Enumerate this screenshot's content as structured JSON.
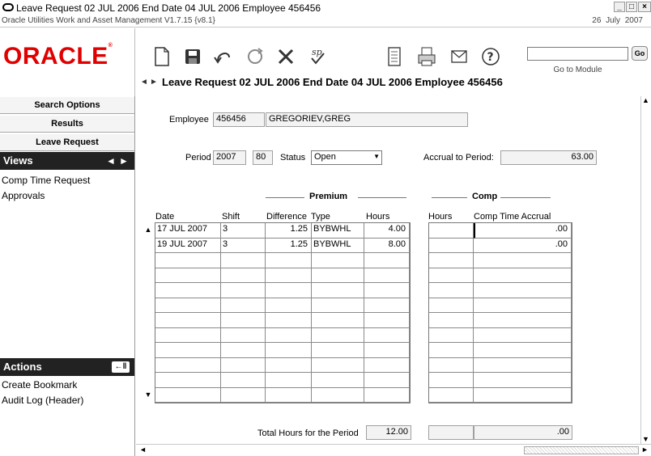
{
  "window": {
    "title": "Leave Request 02 JUL 2006 End Date 04 JUL 2006 Employee 456456",
    "subtitle": "Oracle Utilities Work and Asset Management V1.7.15 {v8.1}",
    "date": "26 July  2007",
    "minimize": "_",
    "maximize": "□",
    "close": "×"
  },
  "logo": {
    "text": "ORACLE",
    "reg": "®"
  },
  "toolbar": {
    "goto_label": "Go to Module",
    "goto_value": "",
    "go_label": "Go",
    "record_title": "Leave Request 02 JUL 2006 End Date 04 JUL 2006 Employee 456456",
    "prev_icon": "◄",
    "next_icon": "►",
    "icons": [
      "new-document-icon",
      "save-icon",
      "undo-icon",
      "refresh-icon",
      "delete-icon",
      "spell-check-icon",
      "report-icon",
      "print-icon",
      "mail-icon",
      "help-icon"
    ]
  },
  "sidebar": {
    "search_options": "Search Options",
    "results": "Results",
    "leave_request": "Leave Request",
    "views_header": "Views",
    "views_items": [
      "Comp Time Request",
      "Approvals"
    ],
    "actions_header": "Actions",
    "actions_items": [
      "Create Bookmark",
      "Audit Log (Header)"
    ],
    "arrow_left": "◄",
    "arrow_right": "►"
  },
  "form": {
    "employee_label": "Employee",
    "employee_id": "456456",
    "employee_name": "GREGORIEV,GREG",
    "period_label": "Period",
    "period_year": "2007",
    "period_num": "80",
    "status_label": "Status",
    "status_value": "Open",
    "accrual_label": "Accrual to Period:",
    "accrual_value": "63.00"
  },
  "grid": {
    "premium_header": "Premium",
    "comp_header": "Comp",
    "columns": {
      "date": "Date",
      "shift": "Shift",
      "difference": "Difference",
      "type": "Type",
      "hours": "Hours",
      "comp_hours": "Hours",
      "comp_accrual": "Comp Time Accrual"
    },
    "rows": [
      {
        "date": "17 JUL 2007",
        "shift": "3",
        "difference": "1.25",
        "type": "BYBWHL",
        "hours": "4.00",
        "comp_hours": "",
        "comp_accrual": ".00"
      },
      {
        "date": "19 JUL 2007",
        "shift": "3",
        "difference": "1.25",
        "type": "BYBWHL",
        "hours": "8.00",
        "comp_hours": "",
        "comp_accrual": ".00"
      }
    ],
    "empty_rows": 10,
    "total_label": "Total Hours for the Period",
    "total_hours": "12.00",
    "total_comp_hours": "",
    "total_comp_accrual": ".00"
  }
}
